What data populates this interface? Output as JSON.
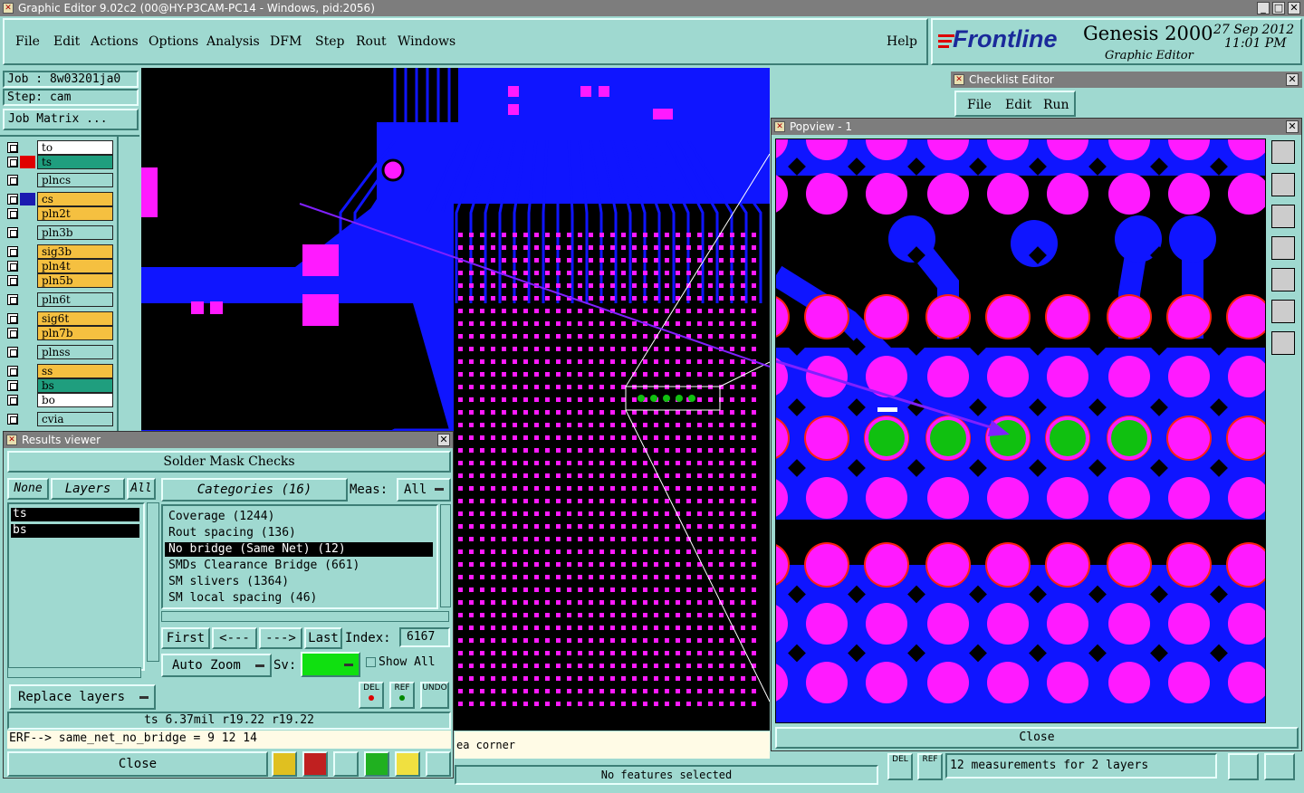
{
  "window": {
    "title": "Graphic Editor 9.02c2 (00@HY-P3CAM-PC14 - Windows, pid:2056)"
  },
  "menu": [
    "File",
    "Edit",
    "Actions",
    "Options",
    "Analysis",
    "DFM",
    "Step",
    "Rout",
    "Windows"
  ],
  "help": "Help",
  "brand": {
    "logo": "Frontline",
    "product": "Genesis 2000",
    "subtitle": "Graphic Editor",
    "date": "27 Sep 2012",
    "time": "11:01 PM"
  },
  "job": {
    "job": "Job : 8w03201ja0",
    "step": "Step: cam",
    "matrix_button": "Job Matrix ..."
  },
  "layers": [
    {
      "name": "to",
      "color": "#ffffff",
      "ind": ""
    },
    {
      "name": "ts",
      "color": "#1f9e7e",
      "ind": "#e00000"
    },
    {
      "name": "plncs",
      "color": "#9fd9d0",
      "ind": ""
    },
    {
      "name": "cs",
      "color": "#f5c040",
      "ind": "#1a1ab0"
    },
    {
      "name": "pln2t",
      "color": "#f5c040",
      "ind": ""
    },
    {
      "name": "pln3b",
      "color": "#9fd9d0",
      "ind": ""
    },
    {
      "name": "sig3b",
      "color": "#f5c040",
      "ind": ""
    },
    {
      "name": "pln4t",
      "color": "#f5c040",
      "ind": ""
    },
    {
      "name": "pln5b",
      "color": "#f5c040",
      "ind": ""
    },
    {
      "name": "pln6t",
      "color": "#9fd9d0",
      "ind": ""
    },
    {
      "name": "sig6t",
      "color": "#f5c040",
      "ind": ""
    },
    {
      "name": "pln7b",
      "color": "#f5c040",
      "ind": ""
    },
    {
      "name": "plnss",
      "color": "#9fd9d0",
      "ind": ""
    },
    {
      "name": "ss",
      "color": "#f5c040",
      "ind": ""
    },
    {
      "name": "bs",
      "color": "#1f9e7e",
      "ind": ""
    },
    {
      "name": "bo",
      "color": "#ffffff",
      "ind": ""
    },
    {
      "name": "cvia",
      "color": "#9fd9d0",
      "ind": ""
    }
  ],
  "checklist": {
    "title": "Checklist Editor",
    "menu": [
      "File",
      "Edit",
      "Run"
    ]
  },
  "popview": {
    "title": "Popview - 1",
    "close": "Close"
  },
  "results": {
    "title": "Results viewer",
    "header": "Solder Mask Checks",
    "none": "None",
    "layers_tab": "Layers",
    "all": "All",
    "layer_list": [
      "ts",
      "bs"
    ],
    "categories_button": "Categories (16)",
    "meas_label": "Meas:",
    "meas_value": "All",
    "categories": [
      "Coverage (1244)",
      "Rout spacing (136)",
      "No bridge (Same Net) (12)",
      "SMDs Clearance Bridge (661)",
      "SM slivers (1364)",
      "SM local spacing (46)"
    ],
    "selected_index": 2,
    "nav": {
      "first": "First",
      "prev": "<---",
      "next": "--->",
      "last": "Last",
      "index_label": "Index:",
      "index_value": "6167"
    },
    "auto_zoom": "Auto Zoom",
    "sv_label": "Sv:",
    "show_all": "Show All",
    "replace_layers": "Replace layers",
    "del": "DEL",
    "ref": "REF",
    "undo": "UNDO",
    "info": "ts 6.37mil   r19.22   r19.22",
    "erf": "ERF--> same_net_no_bridge = 9 12 14",
    "close": "Close"
  },
  "status": {
    "area": "ea corner",
    "features": "No features selected",
    "measurements": "12 measurements for 2 layers"
  },
  "colors": {
    "bg": "#9fd9d0",
    "board": "#0f15ff",
    "pad": "#ff1aff",
    "pad_ring": "#ff2010",
    "drill": "#000000",
    "highlight": "#10c010",
    "arrow": "#8020ff"
  }
}
